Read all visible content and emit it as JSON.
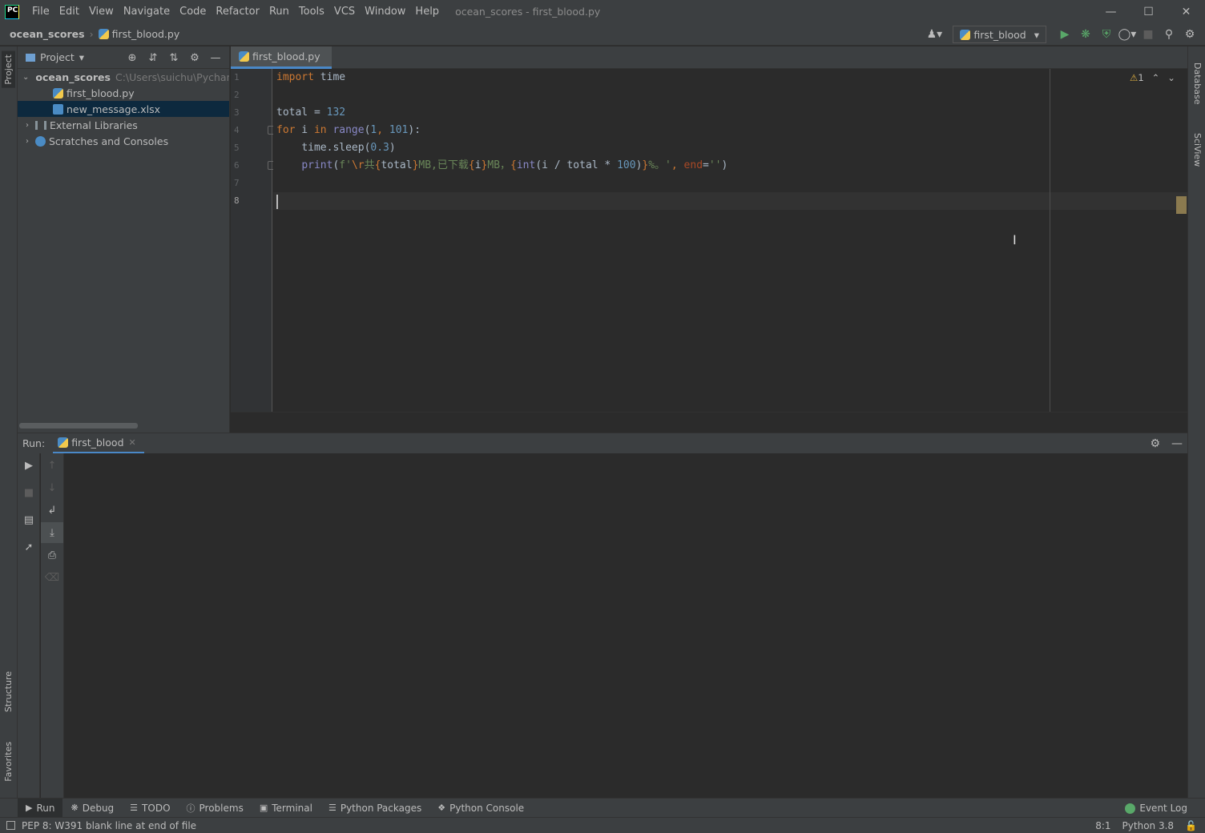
{
  "window": {
    "logo_text": "PC",
    "title": "ocean_scores - first_blood.py",
    "menu": [
      "File",
      "Edit",
      "View",
      "Navigate",
      "Code",
      "Refactor",
      "Run",
      "Tools",
      "VCS",
      "Window",
      "Help"
    ]
  },
  "navbar": {
    "project": "ocean_scores",
    "file": "first_blood.py",
    "run_config": "first_blood"
  },
  "project_panel": {
    "title": "Project",
    "tree": {
      "root": "ocean_scores",
      "root_path": "C:\\Users\\suichu\\Pychan",
      "files": [
        "first_blood.py",
        "new_message.xlsx"
      ],
      "external": "External Libraries",
      "scratches": "Scratches and Consoles"
    }
  },
  "left_stripe": {
    "project": "Project",
    "structure": "Structure",
    "favorites": "Favorites"
  },
  "right_stripe": {
    "database": "Database",
    "sciview": "SciView"
  },
  "editor": {
    "tab": "first_blood.py",
    "line_numbers": [
      "1",
      "2",
      "3",
      "4",
      "5",
      "6",
      "7",
      "8"
    ],
    "warnings_count": "1",
    "code": {
      "l1_kw": "import",
      "l1_rest": " time",
      "l3_var": "total = ",
      "l3_num": "132",
      "l4_for": "for",
      "l4_i": " i ",
      "l4_in": "in",
      "l4_range": " range",
      "l4_open": "(",
      "l4_n1": "1",
      "l4_comma": ", ",
      "l4_n2": "101",
      "l4_close": "):",
      "l5_indent": "    ",
      "l5_text": "time.sleep(",
      "l5_num": "0.3",
      "l5_close": ")",
      "l6_indent": "    ",
      "l6_print": "print",
      "l6_open": "(",
      "l6_f": "f",
      "l6_q1": "'",
      "l6_esc": "\\r",
      "l6_s1": "共",
      "l6_b1": "{",
      "l6_total": "total",
      "l6_b2": "}",
      "l6_s2": "MB,已下载",
      "l6_b3": "{",
      "l6_i": "i",
      "l6_b4": "}",
      "l6_s3": "MB，",
      "l6_b5": "{",
      "l6_int": "int",
      "l6_expr": "(i / total * ",
      "l6_hundred": "100",
      "l6_expr2": ")",
      "l6_b6": "}",
      "l6_s4": "%。'",
      "l6_comma": ", ",
      "l6_end": "end",
      "l6_eq": "=",
      "l6_empty": "''",
      "l6_close": ")"
    }
  },
  "run_panel": {
    "label": "Run:",
    "tab": "first_blood"
  },
  "tool_bar": {
    "run": "Run",
    "debug": "Debug",
    "todo": "TODO",
    "problems": "Problems",
    "terminal": "Terminal",
    "python_packages": "Python Packages",
    "python_console": "Python Console",
    "event_log": "Event Log"
  },
  "status": {
    "message": "PEP 8: W391 blank line at end of file",
    "position": "8:1",
    "interpreter": "Python 3.8"
  }
}
